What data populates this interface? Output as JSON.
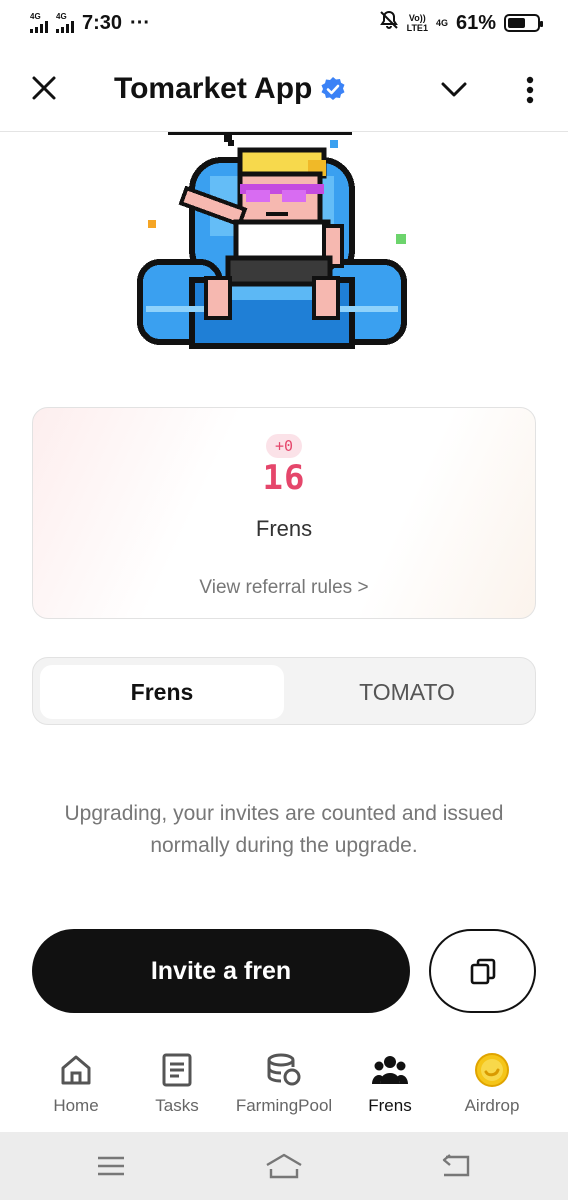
{
  "status_bar": {
    "network_1": "4G",
    "network_2": "4G",
    "time": "7:30",
    "more": "···",
    "volte_top": "Vo))",
    "volte_bottom": "LTE1",
    "net_right": "4G",
    "battery_percent": "61%",
    "battery_level": 0.61
  },
  "header": {
    "title": "Tomarket App",
    "verified": true,
    "accent": "#3b82f6"
  },
  "stats": {
    "delta": "+0",
    "count": "16",
    "label": "Frens",
    "rules_link": "View referral rules >"
  },
  "tabs": {
    "items": [
      {
        "label": "Frens",
        "selected": true
      },
      {
        "label": "TOMATO",
        "selected": false
      }
    ]
  },
  "message": "Upgrading, your invites are counted and issued normally during the upgrade.",
  "actions": {
    "invite_label": "Invite a fren",
    "copy_icon": "copy-icon"
  },
  "bottom_nav": {
    "items": [
      {
        "label": "Home",
        "icon": "home-icon",
        "active": false
      },
      {
        "label": "Tasks",
        "icon": "tasks-icon",
        "active": false
      },
      {
        "label": "FarmingPool",
        "icon": "farming-pool-icon",
        "active": false
      },
      {
        "label": "Frens",
        "icon": "frens-icon",
        "active": true
      },
      {
        "label": "Airdrop",
        "icon": "airdrop-coin-icon",
        "active": false
      }
    ]
  },
  "colors": {
    "brand_red": "#e5466b",
    "primary": "#111111",
    "muted": "#777777",
    "coin": "#f5c518"
  }
}
